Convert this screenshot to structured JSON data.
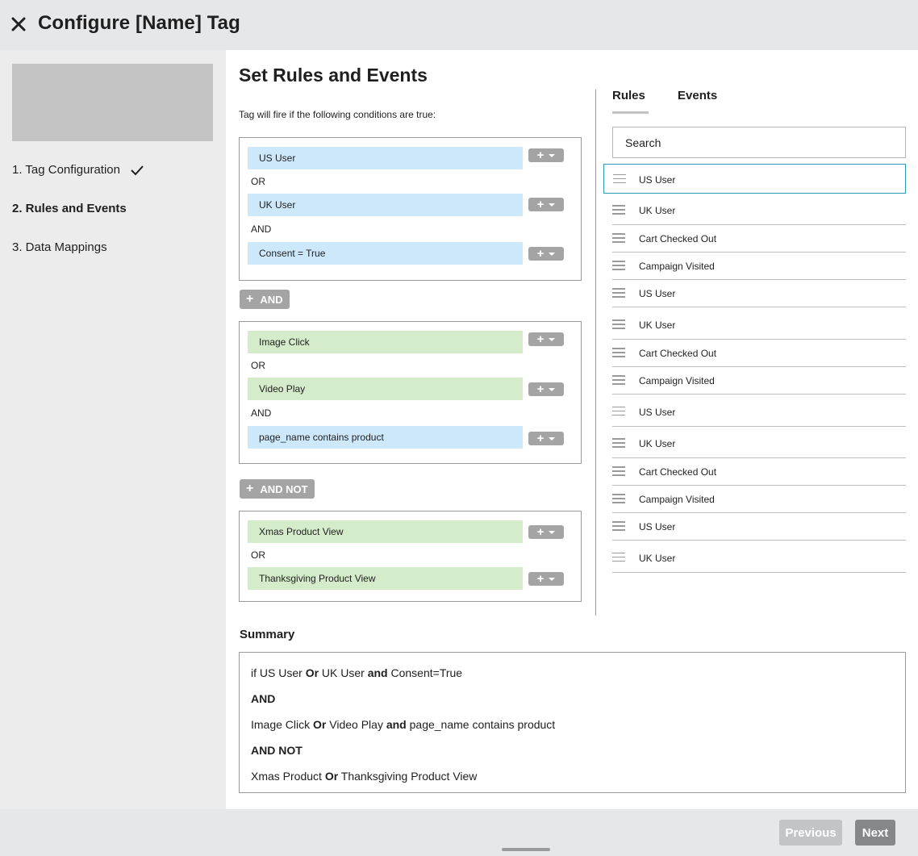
{
  "header": {
    "title": "Configure [Name] Tag"
  },
  "sidebar": {
    "steps": [
      {
        "label": "1. Tag Configuration"
      },
      {
        "label": "2. Rules and Events"
      },
      {
        "label": "3. Data Mappings"
      }
    ]
  },
  "main": {
    "title": "Set Rules and Events",
    "subtitle": "Tag will fire if the following conditions are true:",
    "groups": [
      {
        "conditions": [
          "US User",
          "UK User",
          "Consent = True"
        ],
        "operators": [
          "OR",
          "AND"
        ]
      },
      {
        "conditions": [
          "Image Click",
          "Video Play",
          "page_name contains product"
        ],
        "operators": [
          "OR",
          "AND"
        ]
      },
      {
        "conditions": [
          "Xmas Product View",
          "Thanksgiving Product View"
        ],
        "operators": [
          "OR"
        ]
      }
    ],
    "and_button": "AND",
    "and_not_button": "AND NOT"
  },
  "right_panel": {
    "tabs": [
      "Rules",
      "Events"
    ],
    "search_placeholder": "Search",
    "items": [
      "US User",
      "UK User",
      "Cart Checked Out",
      "Campaign Visited",
      "US User",
      "UK User",
      "Cart Checked Out",
      "Campaign Visited",
      "US User",
      "UK User",
      "Cart Checked Out",
      "Campaign Visited",
      "US User",
      "UK User"
    ]
  },
  "summary": {
    "title": "Summary",
    "line1": {
      "a": "if US User ",
      "b": "Or",
      "c": " UK User ",
      "d": "and",
      "e": " Consent=True"
    },
    "line2": "AND",
    "line3": {
      "a": "Image Click ",
      "b": "Or",
      "c": " Video Play ",
      "d": "and",
      "e": " page_name contains product"
    },
    "line4": "AND NOT",
    "line5": {
      "a": "Xmas Product ",
      "b": "Or",
      "c": " Thanksgiving Product View"
    }
  },
  "footer": {
    "previous": "Previous",
    "next": "Next"
  }
}
